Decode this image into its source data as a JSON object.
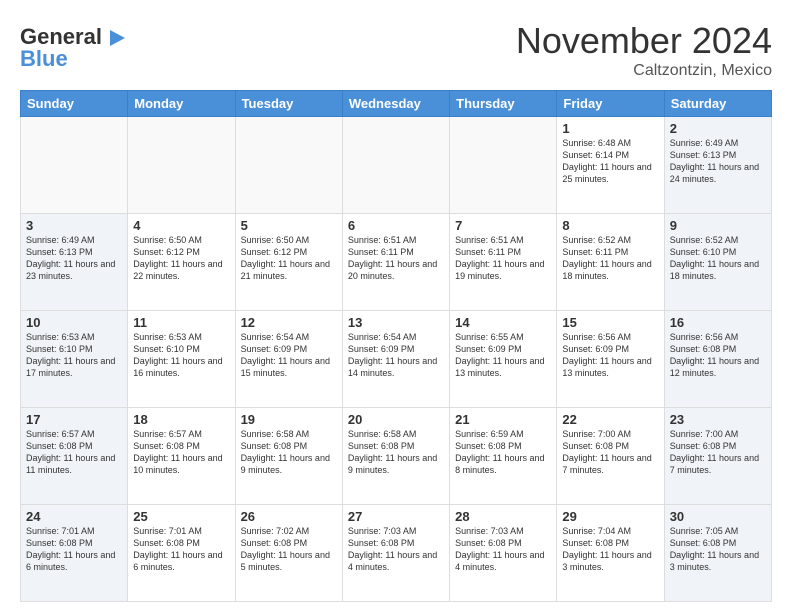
{
  "logo": {
    "line1": "General",
    "line2": "Blue",
    "arrow": "▶"
  },
  "title": "November 2024",
  "subtitle": "Caltzontzin, Mexico",
  "headers": [
    "Sunday",
    "Monday",
    "Tuesday",
    "Wednesday",
    "Thursday",
    "Friday",
    "Saturday"
  ],
  "weeks": [
    [
      {
        "day": "",
        "text": ""
      },
      {
        "day": "",
        "text": ""
      },
      {
        "day": "",
        "text": ""
      },
      {
        "day": "",
        "text": ""
      },
      {
        "day": "",
        "text": ""
      },
      {
        "day": "1",
        "text": "Sunrise: 6:48 AM\nSunset: 6:14 PM\nDaylight: 11 hours and 25 minutes."
      },
      {
        "day": "2",
        "text": "Sunrise: 6:49 AM\nSunset: 6:13 PM\nDaylight: 11 hours and 24 minutes."
      }
    ],
    [
      {
        "day": "3",
        "text": "Sunrise: 6:49 AM\nSunset: 6:13 PM\nDaylight: 11 hours and 23 minutes."
      },
      {
        "day": "4",
        "text": "Sunrise: 6:50 AM\nSunset: 6:12 PM\nDaylight: 11 hours and 22 minutes."
      },
      {
        "day": "5",
        "text": "Sunrise: 6:50 AM\nSunset: 6:12 PM\nDaylight: 11 hours and 21 minutes."
      },
      {
        "day": "6",
        "text": "Sunrise: 6:51 AM\nSunset: 6:11 PM\nDaylight: 11 hours and 20 minutes."
      },
      {
        "day": "7",
        "text": "Sunrise: 6:51 AM\nSunset: 6:11 PM\nDaylight: 11 hours and 19 minutes."
      },
      {
        "day": "8",
        "text": "Sunrise: 6:52 AM\nSunset: 6:11 PM\nDaylight: 11 hours and 18 minutes."
      },
      {
        "day": "9",
        "text": "Sunrise: 6:52 AM\nSunset: 6:10 PM\nDaylight: 11 hours and 18 minutes."
      }
    ],
    [
      {
        "day": "10",
        "text": "Sunrise: 6:53 AM\nSunset: 6:10 PM\nDaylight: 11 hours and 17 minutes."
      },
      {
        "day": "11",
        "text": "Sunrise: 6:53 AM\nSunset: 6:10 PM\nDaylight: 11 hours and 16 minutes."
      },
      {
        "day": "12",
        "text": "Sunrise: 6:54 AM\nSunset: 6:09 PM\nDaylight: 11 hours and 15 minutes."
      },
      {
        "day": "13",
        "text": "Sunrise: 6:54 AM\nSunset: 6:09 PM\nDaylight: 11 hours and 14 minutes."
      },
      {
        "day": "14",
        "text": "Sunrise: 6:55 AM\nSunset: 6:09 PM\nDaylight: 11 hours and 13 minutes."
      },
      {
        "day": "15",
        "text": "Sunrise: 6:56 AM\nSunset: 6:09 PM\nDaylight: 11 hours and 13 minutes."
      },
      {
        "day": "16",
        "text": "Sunrise: 6:56 AM\nSunset: 6:08 PM\nDaylight: 11 hours and 12 minutes."
      }
    ],
    [
      {
        "day": "17",
        "text": "Sunrise: 6:57 AM\nSunset: 6:08 PM\nDaylight: 11 hours and 11 minutes."
      },
      {
        "day": "18",
        "text": "Sunrise: 6:57 AM\nSunset: 6:08 PM\nDaylight: 11 hours and 10 minutes."
      },
      {
        "day": "19",
        "text": "Sunrise: 6:58 AM\nSunset: 6:08 PM\nDaylight: 11 hours and 9 minutes."
      },
      {
        "day": "20",
        "text": "Sunrise: 6:58 AM\nSunset: 6:08 PM\nDaylight: 11 hours and 9 minutes."
      },
      {
        "day": "21",
        "text": "Sunrise: 6:59 AM\nSunset: 6:08 PM\nDaylight: 11 hours and 8 minutes."
      },
      {
        "day": "22",
        "text": "Sunrise: 7:00 AM\nSunset: 6:08 PM\nDaylight: 11 hours and 7 minutes."
      },
      {
        "day": "23",
        "text": "Sunrise: 7:00 AM\nSunset: 6:08 PM\nDaylight: 11 hours and 7 minutes."
      }
    ],
    [
      {
        "day": "24",
        "text": "Sunrise: 7:01 AM\nSunset: 6:08 PM\nDaylight: 11 hours and 6 minutes."
      },
      {
        "day": "25",
        "text": "Sunrise: 7:01 AM\nSunset: 6:08 PM\nDaylight: 11 hours and 6 minutes."
      },
      {
        "day": "26",
        "text": "Sunrise: 7:02 AM\nSunset: 6:08 PM\nDaylight: 11 hours and 5 minutes."
      },
      {
        "day": "27",
        "text": "Sunrise: 7:03 AM\nSunset: 6:08 PM\nDaylight: 11 hours and 4 minutes."
      },
      {
        "day": "28",
        "text": "Sunrise: 7:03 AM\nSunset: 6:08 PM\nDaylight: 11 hours and 4 minutes."
      },
      {
        "day": "29",
        "text": "Sunrise: 7:04 AM\nSunset: 6:08 PM\nDaylight: 11 hours and 3 minutes."
      },
      {
        "day": "30",
        "text": "Sunrise: 7:05 AM\nSunset: 6:08 PM\nDaylight: 11 hours and 3 minutes."
      }
    ]
  ]
}
